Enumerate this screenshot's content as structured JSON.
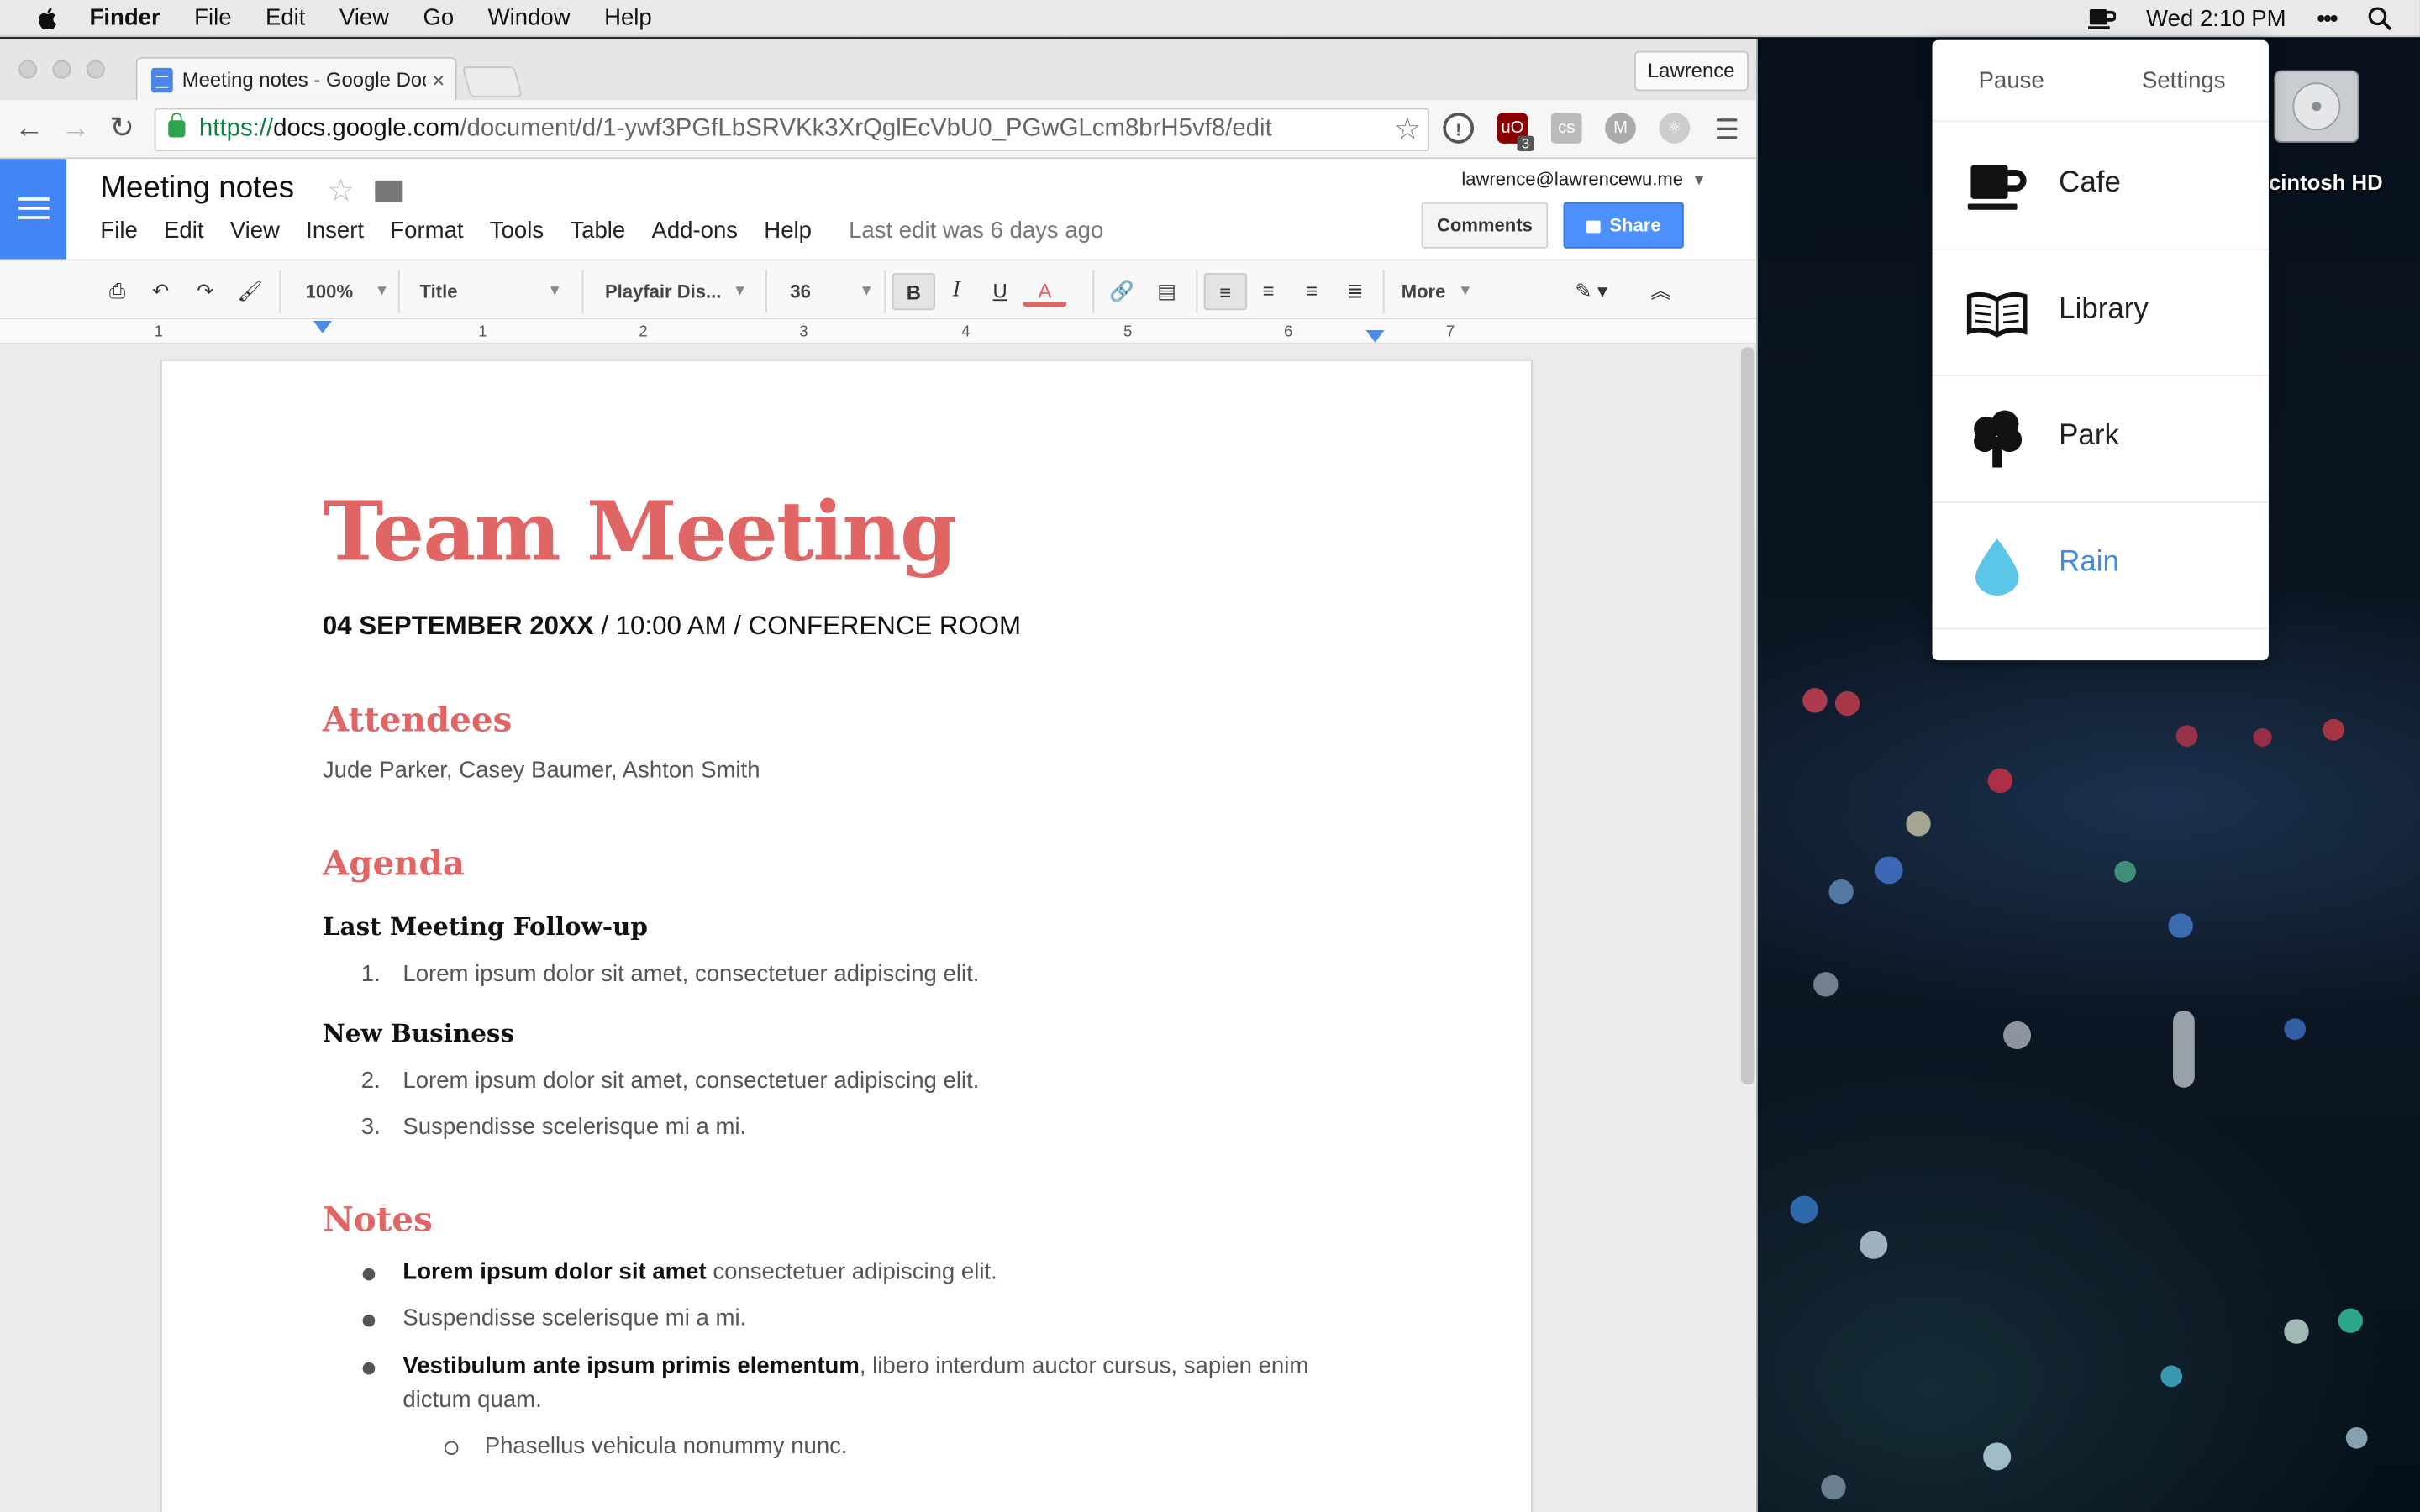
{
  "menubar": {
    "app": "Finder",
    "items": [
      "File",
      "Edit",
      "View",
      "Go",
      "Window",
      "Help"
    ],
    "clock": "Wed 2:10 PM",
    "overflow": "•••"
  },
  "desktop": {
    "drive_label": "cintosh HD"
  },
  "browser": {
    "tab_title": "Meeting notes - Google Docs",
    "tab_close": "×",
    "profile_button": "Lawrence",
    "url_scheme": "https://",
    "url_host": "docs.google.com",
    "url_path": "/document/d/1-ywf3PGfLbSRVKk3XrQglEcVbU0_PGwGLcm8brH5vf8/edit",
    "ublock_badge": "3"
  },
  "docs": {
    "title": "Meeting notes",
    "menu": [
      "File",
      "Edit",
      "View",
      "Insert",
      "Format",
      "Tools",
      "Table",
      "Add-ons",
      "Help"
    ],
    "last_edit": "Last edit was 6 days ago",
    "account": "lawrence@lawrencewu.me",
    "comments_label": "Comments",
    "share_label": "Share",
    "toolbar": {
      "zoom": "100%",
      "style": "Title",
      "font": "Playfair Dis...",
      "size": "36",
      "more": "More"
    },
    "ruler_ticks": [
      "1",
      "1",
      "2",
      "3",
      "4",
      "5",
      "6",
      "7"
    ]
  },
  "document": {
    "title": "Team Meeting",
    "subtitle_bold": "04 SEPTEMBER 20XX",
    "subtitle_rest": " / 10:00 AM / CONFERENCE ROOM",
    "attendees_heading": "Attendees",
    "attendees_text": "Jude Parker, Casey Baumer, Ashton Smith",
    "agenda_heading": "Agenda",
    "followup_heading": "Last Meeting Follow-up",
    "followup_items": [
      {
        "num": "1.",
        "text": "Lorem ipsum dolor sit amet, consectetuer adipiscing elit."
      }
    ],
    "newbiz_heading": "New Business",
    "newbiz_items": [
      {
        "num": "2.",
        "text": "Lorem ipsum dolor sit amet, consectetuer adipiscing elit."
      },
      {
        "num": "3.",
        "text": "Suspendisse scelerisque mi a mi."
      }
    ],
    "notes_heading": "Notes",
    "notes_items": [
      {
        "bold": "Lorem ipsum dolor sit amet",
        "text": " consectetuer adipiscing elit."
      },
      {
        "bold": "",
        "text": "Suspendisse scelerisque mi a mi."
      },
      {
        "bold": "Vestibulum ante ipsum primis elementum",
        "text": ", libero interdum auctor cursus, sapien enim",
        "text2": "dictum quam."
      }
    ],
    "sub_item": "Phasellus vehicula nonummy nunc."
  },
  "sounds_popover": {
    "pause_label": "Pause",
    "settings_label": "Settings",
    "sounds": [
      {
        "name": "Cafe",
        "icon": "coffee-cup-icon",
        "active": false
      },
      {
        "name": "Library",
        "icon": "open-book-icon",
        "active": false
      },
      {
        "name": "Park",
        "icon": "tree-icon",
        "active": false
      },
      {
        "name": "Rain",
        "icon": "raindrop-icon",
        "active": true
      }
    ],
    "active_color": "#3a8ee6"
  },
  "colors": {
    "heading_red": "#e06666",
    "docs_blue": "#4285f4",
    "share_blue": "#4d90fe"
  }
}
